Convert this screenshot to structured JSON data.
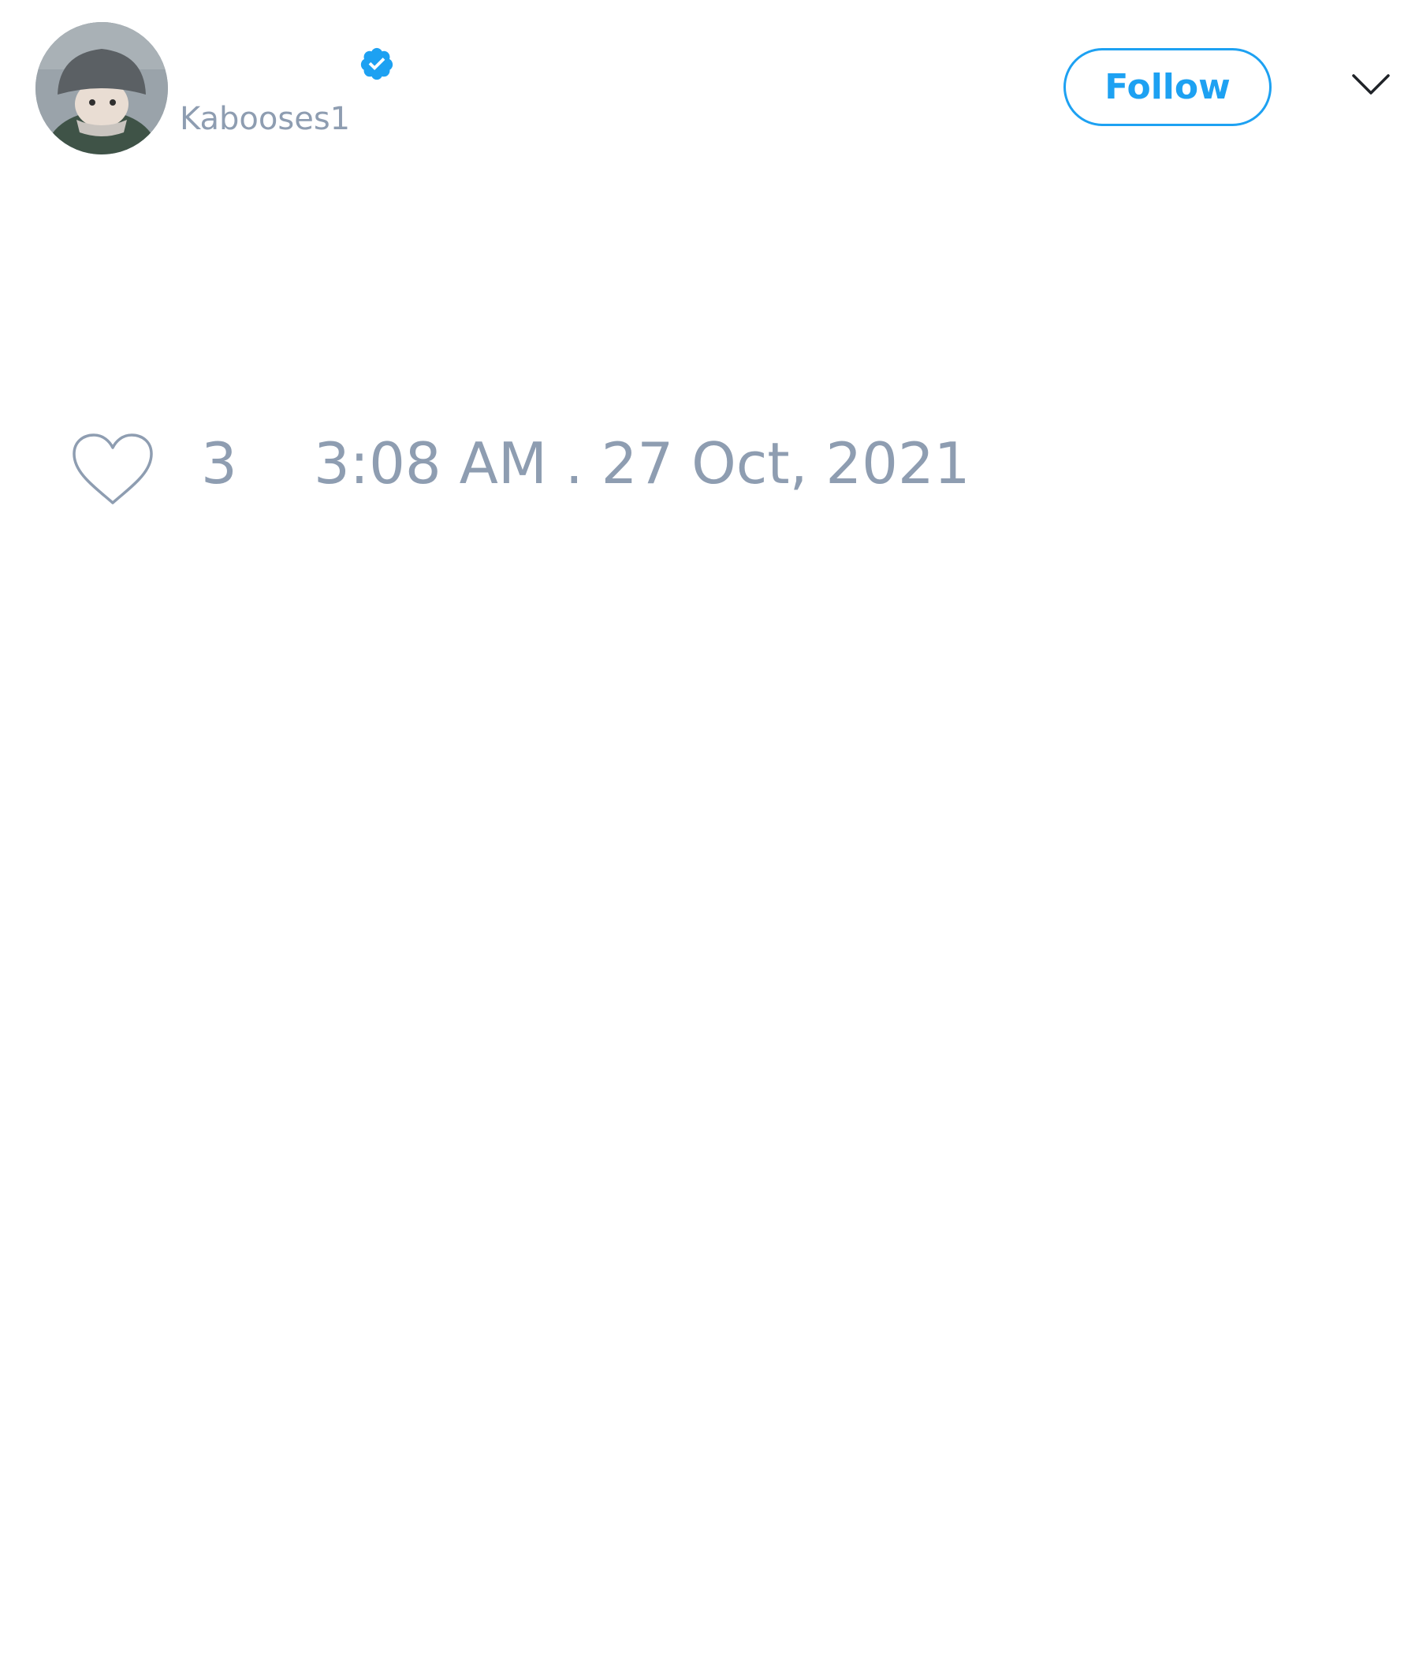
{
  "tweet": {
    "author": {
      "handle": "Kabooses1",
      "verified": true,
      "avatar_icon": "user-avatar"
    },
    "follow_label": "Follow",
    "menu_icon": "chevron-down-icon",
    "likes": {
      "icon": "heart-icon",
      "count": "3"
    },
    "timestamp": "3:08 AM . 27 Oct, 2021"
  },
  "colors": {
    "accent": "#1da1f2",
    "muted": "#8e9db1",
    "background": "#ffffff"
  }
}
